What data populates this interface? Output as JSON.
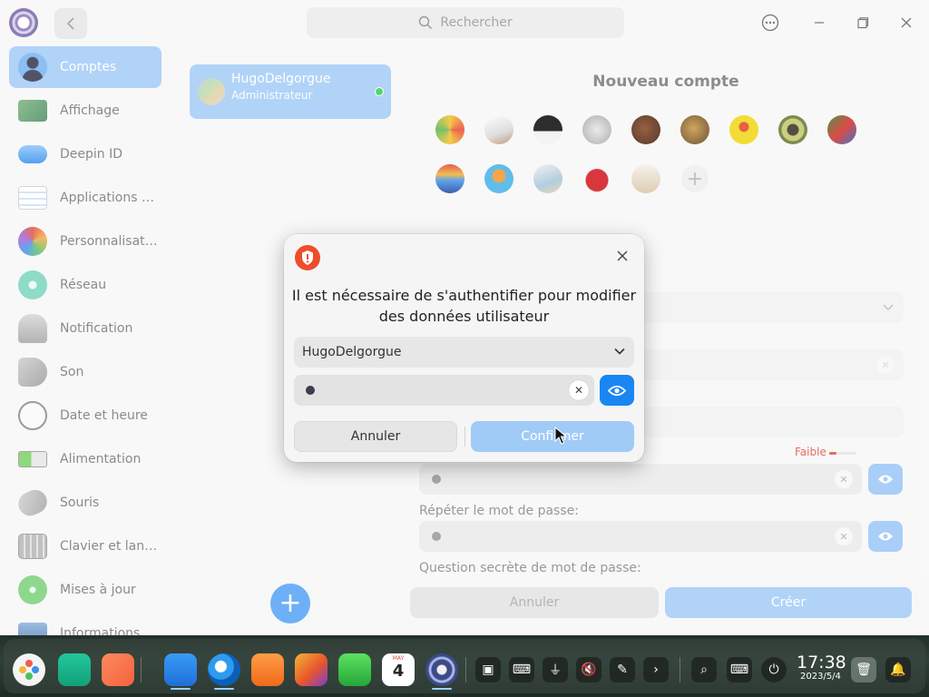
{
  "titlebar": {
    "search_placeholder": "Rechercher",
    "icons": [
      "control-center-logo-icon",
      "back-arrow-icon",
      "search-icon",
      "menu-icon",
      "minimize-icon",
      "maximize-icon",
      "close-icon"
    ]
  },
  "sidebar": {
    "items": [
      {
        "label": "Comptes",
        "icon": "accounts-icon",
        "active": true
      },
      {
        "label": "Affichage",
        "icon": "display-icon"
      },
      {
        "label": "Deepin ID",
        "icon": "cloud-icon"
      },
      {
        "label": "Applications par défaut",
        "icon": "default-apps-icon"
      },
      {
        "label": "Personnalisation",
        "icon": "personalization-icon"
      },
      {
        "label": "Réseau",
        "icon": "network-icon"
      },
      {
        "label": "Notification",
        "icon": "bell-icon"
      },
      {
        "label": "Son",
        "icon": "speaker-icon"
      },
      {
        "label": "Date et heure",
        "icon": "clock-icon"
      },
      {
        "label": "Alimentation",
        "icon": "battery-icon"
      },
      {
        "label": "Souris",
        "icon": "mouse-icon"
      },
      {
        "label": "Clavier et langue",
        "icon": "keyboard-icon"
      },
      {
        "label": "Mises à jour",
        "icon": "update-icon"
      },
      {
        "label": "Informations système",
        "icon": "info-icon"
      }
    ]
  },
  "users": {
    "current": {
      "name": "HugoDelgorgue",
      "role": "Administrateur",
      "status": "online"
    }
  },
  "new_account": {
    "title": "Nouveau compte",
    "strength_label": "Faible",
    "repeat_password_label": "Répéter le mot de passe:",
    "secret_question_label": "Question secrète de mot de passe:",
    "cancel_label": "Annuler",
    "create_label": "Créer"
  },
  "dialog": {
    "message": "Il est nécessaire de s'authentifier pour modifier des données utilisateur",
    "user_select": "HugoDelgorgue",
    "cancel_label": "Annuler",
    "confirm_label": "Confirmer"
  },
  "dock": {
    "time": "17:38",
    "date": "2023/5/4",
    "calendar_month": "MAY",
    "calendar_day": "4"
  },
  "colors": {
    "accent": "#1a86f2",
    "accent_light": "#a7cdf8",
    "warning_icon": "#ee4d2d",
    "strength_weak": "#e8564a"
  }
}
